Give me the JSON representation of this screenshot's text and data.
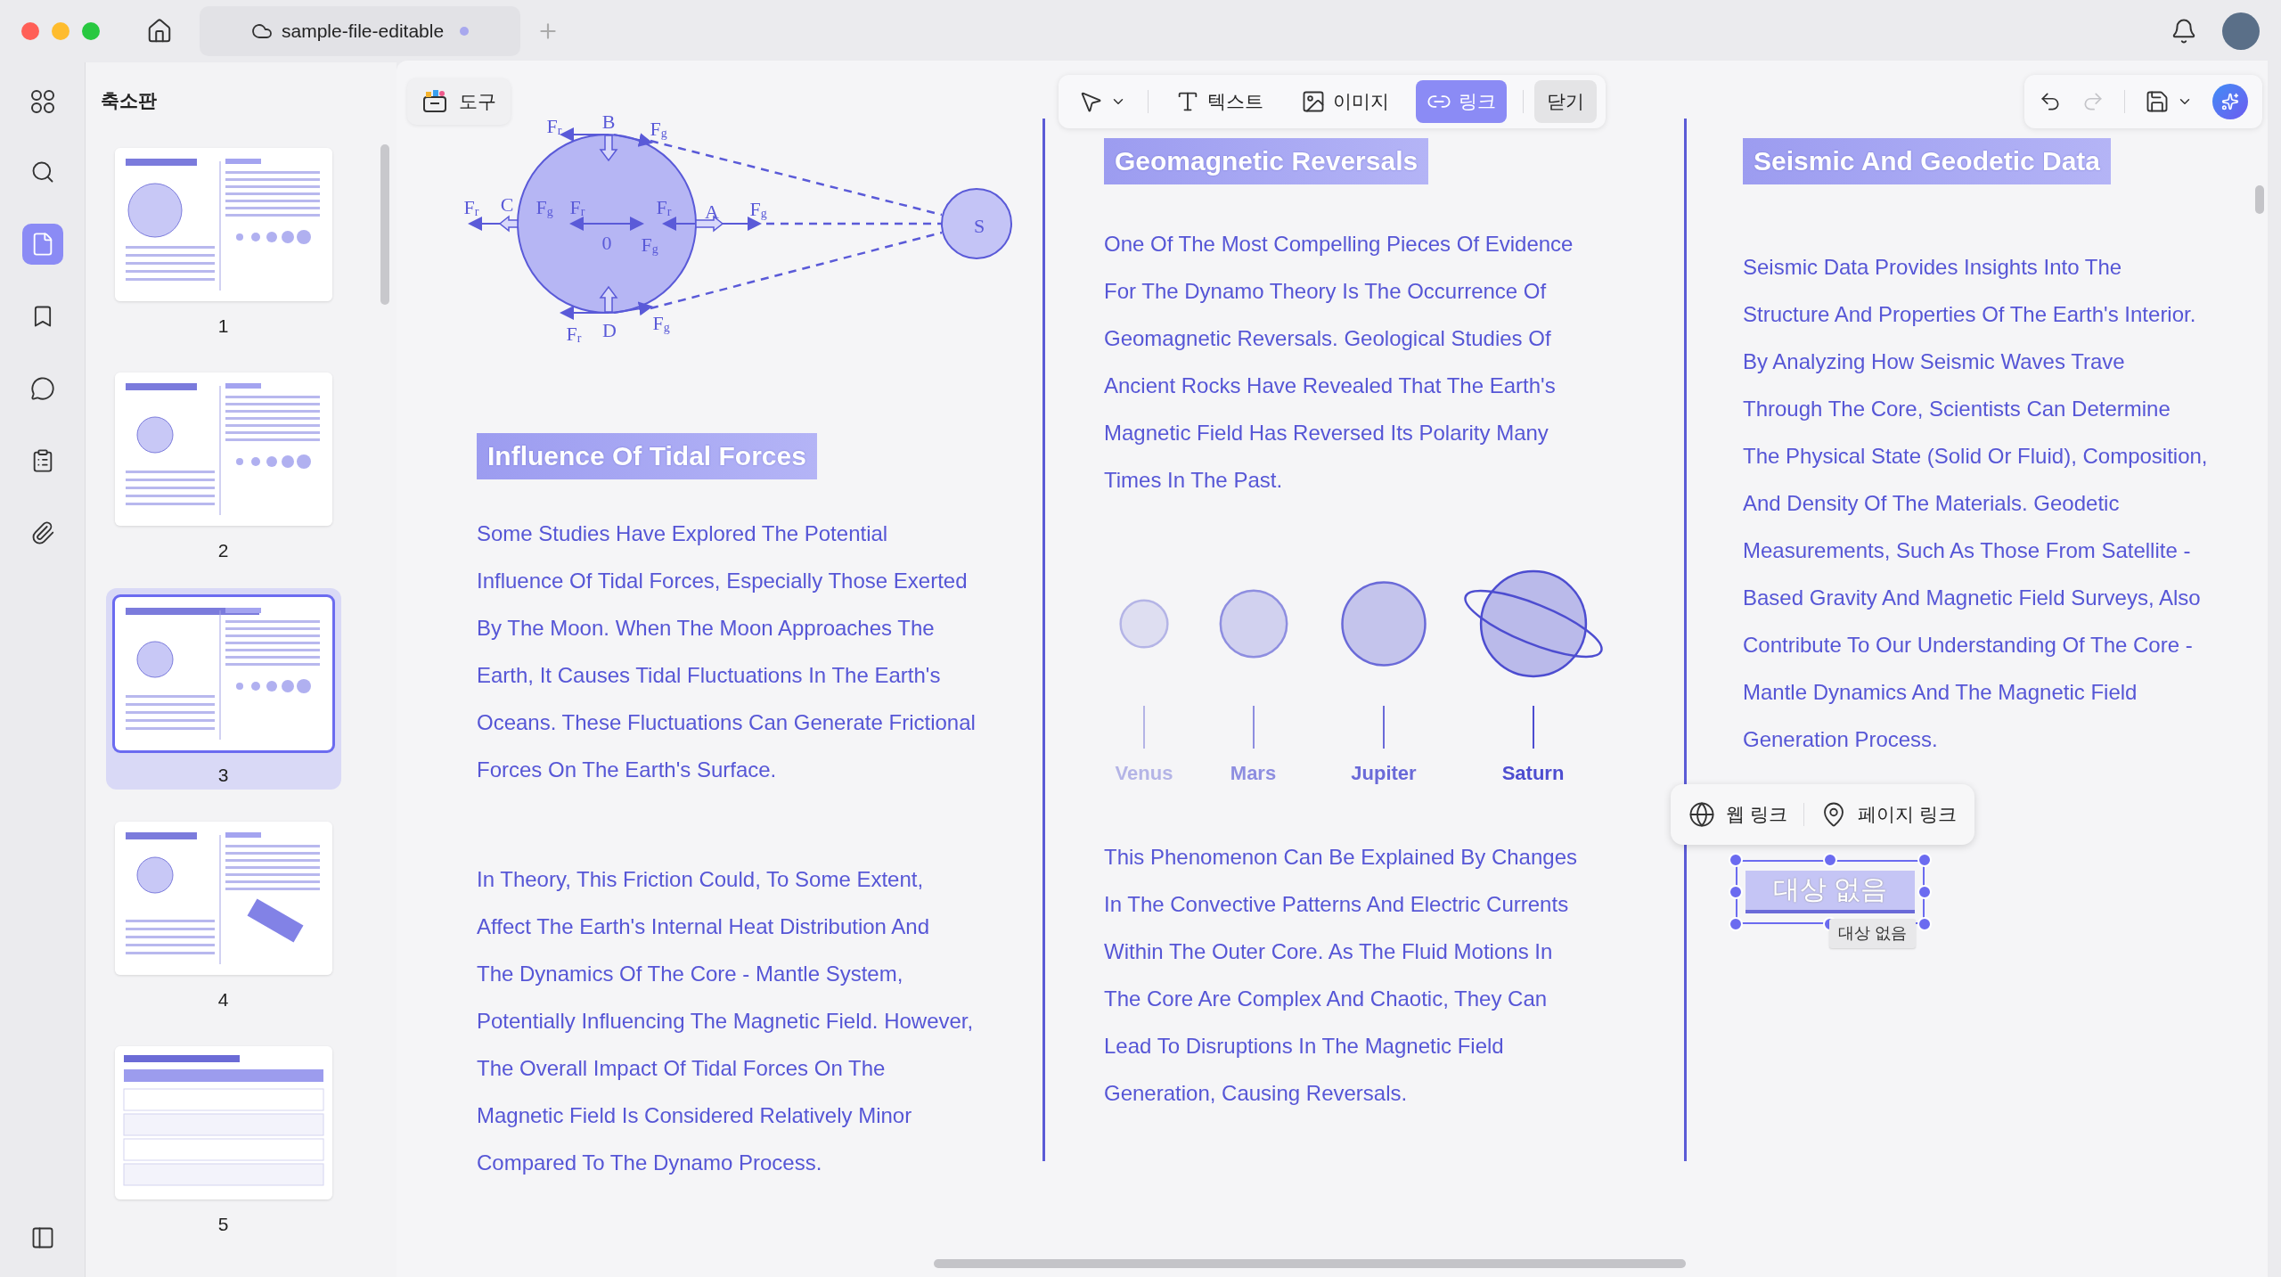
{
  "window": {
    "tab": {
      "title": "sample-file-editable",
      "unsaved": true
    }
  },
  "rail": [
    {
      "kind": "search",
      "selected": false
    },
    {
      "kind": "pages",
      "selected": true
    },
    {
      "kind": "bookmark",
      "selected": false
    },
    {
      "kind": "comment",
      "selected": false
    },
    {
      "kind": "form",
      "selected": false
    },
    {
      "kind": "attachment",
      "selected": false
    }
  ],
  "thumbnails": {
    "title": "축소판",
    "pages": [
      {
        "number": "1",
        "selected": false
      },
      {
        "number": "2",
        "selected": false
      },
      {
        "number": "3",
        "selected": true
      },
      {
        "number": "4",
        "selected": false
      },
      {
        "number": "5",
        "selected": false
      }
    ]
  },
  "toolbar": {
    "tools_label": "도구",
    "modes": [
      {
        "kind": "select",
        "selected": false
      },
      {
        "kind": "text",
        "label": "텍스트",
        "selected": false
      },
      {
        "kind": "image",
        "label": "이미지",
        "selected": false
      },
      {
        "kind": "link",
        "label": "링크",
        "selected": true
      }
    ],
    "close_label": "닫기",
    "redo_disabled": true
  },
  "document": {
    "diagram_labels": [
      {
        "text": "F",
        "sub": "r"
      },
      {
        "text": "B"
      },
      {
        "text": "F",
        "sub": "g"
      },
      {
        "text": "F",
        "sub": "r"
      },
      {
        "text": "C"
      },
      {
        "text": "F",
        "sub": "g"
      },
      {
        "text": "F",
        "sub": "r"
      },
      {
        "text": "F",
        "sub": "r"
      },
      {
        "text": "A"
      },
      {
        "text": "F",
        "sub": "g"
      },
      {
        "text": "0"
      },
      {
        "text": "F",
        "sub": "g"
      },
      {
        "text": "F",
        "sub": "r"
      },
      {
        "text": "D"
      },
      {
        "text": "F",
        "sub": "g"
      },
      {
        "text": "S"
      }
    ],
    "columns": [
      {
        "blocks": [
          {
            "kind": "diagram"
          },
          {
            "kind": "heading",
            "text": "Influence Of Tidal Forces"
          },
          {
            "kind": "paragraph",
            "lines": [
              "Some Studies Have Explored The Potential",
              "Influence Of Tidal Forces, Especially Those Exerted",
              "By The Moon. When The Moon Approaches The",
              "Earth, It Causes Tidal Fluctuations In The Earth's",
              "Oceans. These Fluctuations Can Generate Frictional",
              "Forces On The Earth's Surface."
            ]
          },
          {
            "kind": "paragraph",
            "lines": [
              "In Theory, This Friction Could, To Some Extent,",
              "Affect The Earth's Internal Heat Distribution And",
              "The Dynamics Of The Core - Mantle System,",
              "Potentially Influencing The Magnetic Field. However,",
              "The Overall Impact Of Tidal Forces On The",
              "Magnetic Field Is Considered Relatively Minor",
              "Compared To The Dynamo Process."
            ]
          }
        ]
      },
      {
        "blocks": [
          {
            "kind": "heading",
            "text": "Geomagnetic Reversals"
          },
          {
            "kind": "paragraph",
            "lines": [
              "One Of The Most Compelling Pieces Of Evidence",
              "For The Dynamo Theory Is The Occurrence Of",
              "Geomagnetic Reversals. Geological Studies Of",
              "Ancient Rocks Have Revealed That The Earth's",
              "Magnetic Field Has Reversed Its Polarity Many",
              "Times In The Past."
            ]
          },
          {
            "kind": "planets",
            "items": [
              {
                "name": "Venus",
                "kind": "plain",
                "color": "#b4b4e6"
              },
              {
                "name": "Mars",
                "kind": "plain",
                "color": "#8e8ee0"
              },
              {
                "name": "Jupiter",
                "kind": "plain",
                "color": "#6a6ad8"
              },
              {
                "name": "Saturn",
                "kind": "ringed",
                "color": "#4d4dd0"
              }
            ]
          },
          {
            "kind": "paragraph",
            "lines": [
              "This Phenomenon Can Be Explained By Changes",
              "In The Convective Patterns And Electric Currents",
              "Within The Outer Core. As The Fluid Motions In",
              "The Core Are Complex And Chaotic, They Can",
              "Lead To Disruptions In The Magnetic Field",
              "Generation, Causing Reversals."
            ]
          }
        ]
      },
      {
        "blocks": [
          {
            "kind": "heading",
            "text": "Seismic And Geodetic Data"
          },
          {
            "kind": "paragraph",
            "lines": [
              "Seismic Data Provides Insights Into The",
              "Structure And Properties Of The Earth's Interior.",
              "By Analyzing How Seismic Waves Trave",
              "Through The Core, Scientists Can Determine",
              "The Physical State (Solid Or Fluid), Composition,",
              "And Density Of The Materials. Geodetic",
              "Measurements, Such As Those From Satellite -",
              "Based Gravity And Magnetic Field Surveys, Also",
              "Contribute To Our Understanding Of The Core -",
              "Mantle Dynamics And The Magnetic Field",
              "Generation Process."
            ]
          }
        ]
      }
    ]
  },
  "link_menu": {
    "items": [
      {
        "kind": "web",
        "label": "웹 링크"
      },
      {
        "kind": "page",
        "label": "페이지 링크"
      }
    ]
  },
  "link_box": {
    "text": "대상 없음",
    "tooltip": "대상 없음"
  }
}
